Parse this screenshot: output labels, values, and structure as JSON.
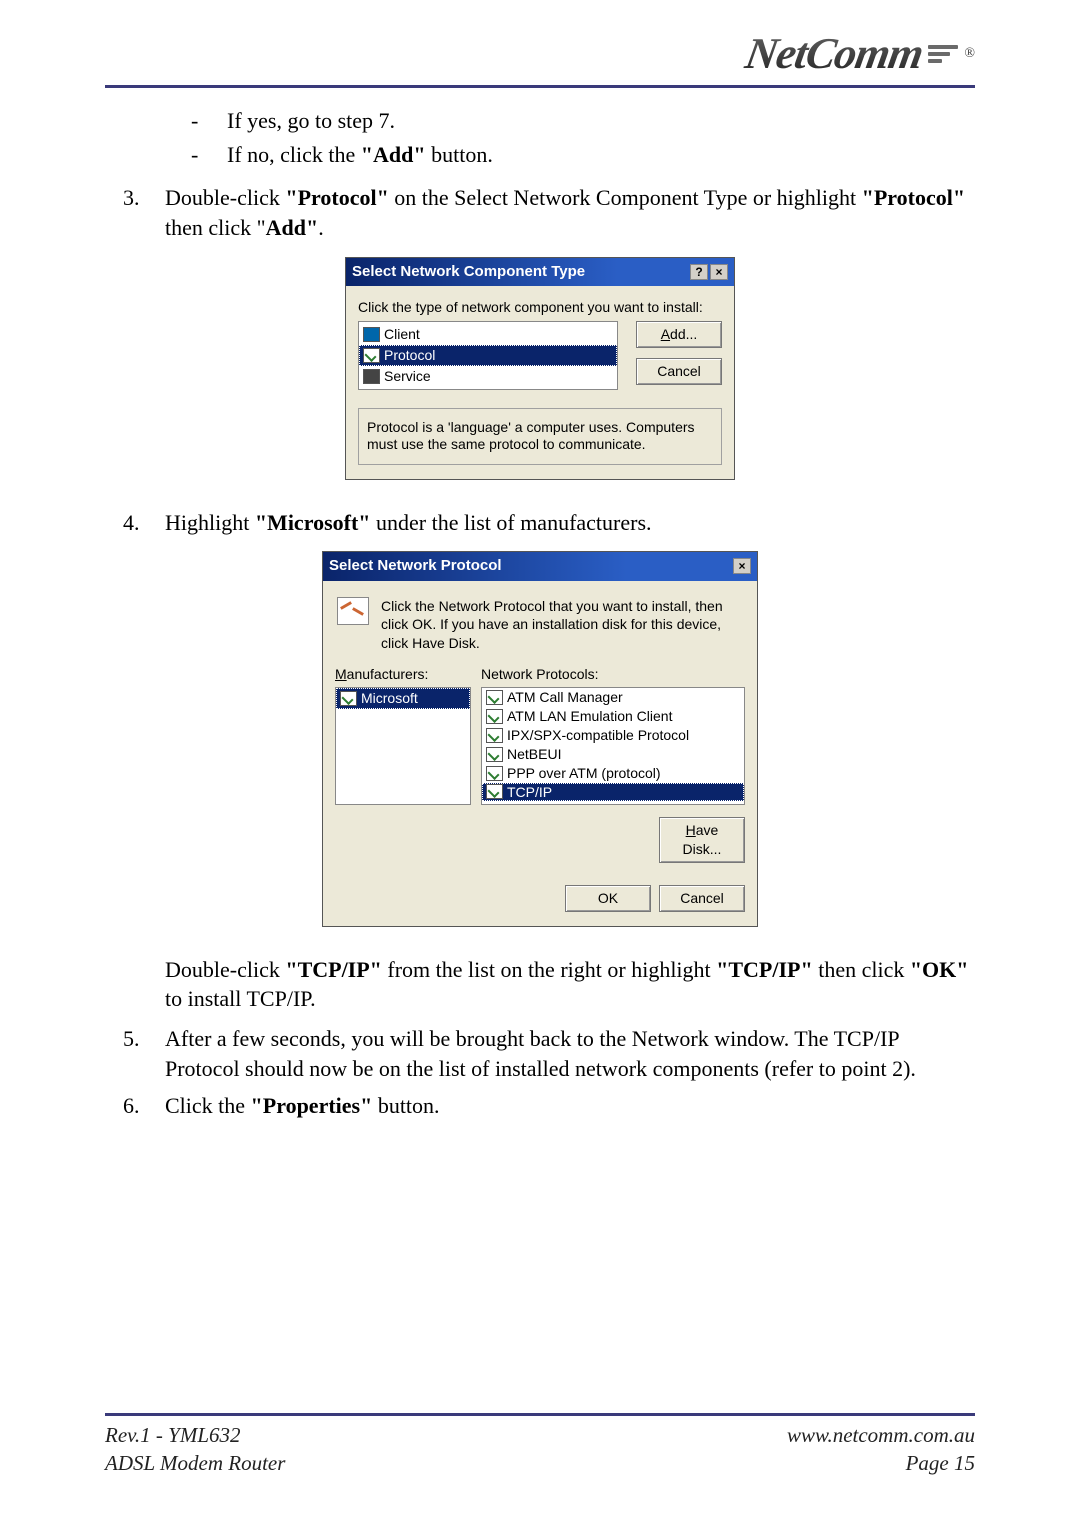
{
  "logo": {
    "text": "NetComm",
    "reg": "®"
  },
  "bullets": {
    "dash1": "If yes, go to step 7.",
    "dash2_pre": "If no, click the ",
    "dash2_bold": "\"Add\"",
    "dash2_post": " button."
  },
  "items": {
    "n3": "3.",
    "n3_pre": "Double-click ",
    "n3_b1": "\"Protocol\"",
    "n3_mid": " on the Select Network Component Type or highlight ",
    "n3_b2": "\"Protocol\"",
    "n3_mid2": " then click \"",
    "n3_b3": "Add\"",
    "n3_post": ".",
    "n4": "4.",
    "n4_pre": "Highlight ",
    "n4_b1": "\"Microsoft\"",
    "n4_post": " under the list of manufacturers.",
    "p4b_pre": "Double-click ",
    "p4b_b1": "\"TCP/IP\"",
    "p4b_mid": " from the list on the right or highlight ",
    "p4b_b2": "\"TCP/IP\"",
    "p4b_mid2": " then click ",
    "p4b_b3": "\"OK\"",
    "p4b_post": " to install TCP/IP.",
    "n5": "5.",
    "n5_txt": "After a few seconds, you will be brought back to the Network window. The TCP/IP Protocol should now be on the list of installed network components (refer to point 2).",
    "n6": "6.",
    "n6_pre": "Click the ",
    "n6_b1": "\"Properties\"",
    "n6_post": " button."
  },
  "dlg1": {
    "title": "Select Network Component Type",
    "help": "?",
    "close": "×",
    "prompt": "Click the type of network component you want to install:",
    "list": {
      "client": "Client",
      "protocol": "Protocol",
      "service": "Service"
    },
    "add_u": "A",
    "add_rest": "dd...",
    "cancel": "Cancel",
    "desc": "Protocol is a 'language' a computer uses. Computers must use the same protocol to communicate."
  },
  "dlg2": {
    "title": "Select Network Protocol",
    "close": "×",
    "desc": "Click the Network Protocol that you want to install, then click OK. If you have an installation disk for this device, click Have Disk.",
    "mfr_u": "M",
    "mfr_rest": "anufacturers:",
    "np_label": "Network Protocols:",
    "mfr": "Microsoft",
    "protos": {
      "p0": "ATM Call Manager",
      "p1": "ATM LAN Emulation Client",
      "p2": "IPX/SPX-compatible Protocol",
      "p3": "NetBEUI",
      "p4": "PPP over ATM (protocol)",
      "p5": "TCP/IP"
    },
    "have_u": "H",
    "have_rest": "ave Disk...",
    "ok": "OK",
    "cancel": "Cancel"
  },
  "footer": {
    "l1": "Rev.1 - YML632",
    "l2": "ADSL Modem Router",
    "r1": "www.netcomm.com.au",
    "r2": "Page 15"
  }
}
